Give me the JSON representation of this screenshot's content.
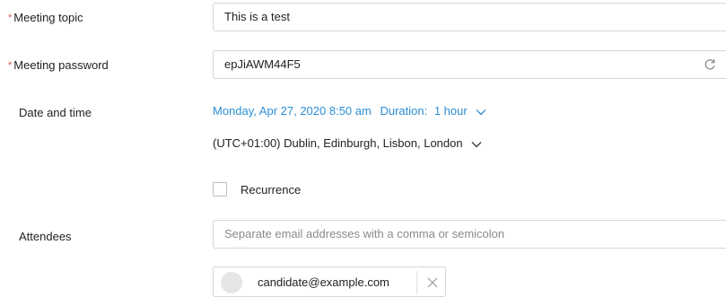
{
  "form": {
    "topic": {
      "label": "Meeting topic",
      "required_mark": "*",
      "value": "This is a test"
    },
    "password": {
      "label": "Meeting password",
      "required_mark": "*",
      "value": "epJiAWM44F5",
      "refresh_icon": "refresh-icon"
    },
    "datetime": {
      "label": "Date and time",
      "date_text": "Monday, Apr 27, 2020 8:50 am",
      "duration_label": "Duration:",
      "duration_value": "1 hour",
      "timezone": "(UTC+01:00) Dublin, Edinburgh, Lisbon, London"
    },
    "recurrence": {
      "label": "Recurrence",
      "checked": false
    },
    "attendees": {
      "label": "Attendees",
      "placeholder": "Separate email addresses with a comma or semicolon",
      "chips": [
        {
          "email": "candidate@example.com"
        }
      ]
    }
  },
  "colors": {
    "accent": "#2d8fd5",
    "required": "#d9534f",
    "border": "#d6d6d6"
  }
}
